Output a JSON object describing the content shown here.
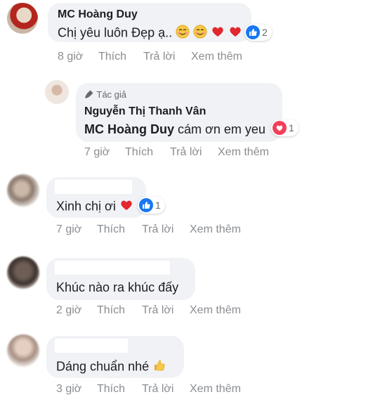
{
  "comments": [
    {
      "author": "MC Hoàng Duy",
      "text": "Chị yêu luôn Đẹp ạ..",
      "time": "8 giờ",
      "like": "Thích",
      "reply": "Trả lời",
      "more": "Xem thêm",
      "reaction_icon": "like-icon",
      "reaction_count": "2"
    },
    {
      "badge": "Tác giả",
      "author": "Nguyễn Thị Thanh Vân",
      "mention": "MC Hoàng Duy",
      "text": "cám ơn em yeu",
      "time": "7 giờ",
      "like": "Thích",
      "reply": "Trả lời",
      "more": "Xem thêm",
      "reaction_icon": "love-icon",
      "reaction_count": "1"
    },
    {
      "text": "Xinh chị ơi",
      "time": "7 giờ",
      "like": "Thích",
      "reply": "Trả lời",
      "more": "Xem thêm",
      "reaction_icon": "like-icon",
      "reaction_count": "1"
    },
    {
      "text": "Khúc nào ra khúc đấy",
      "time": "2 giờ",
      "like": "Thích",
      "reply": "Trả lời",
      "more": "Xem thêm"
    },
    {
      "text": "Dáng chuẩn nhé",
      "time": "3 giờ",
      "like": "Thích",
      "reply": "Trả lời",
      "more": "Xem thêm"
    }
  ],
  "colors": {
    "bubble": "#f0f2f5",
    "meta": "#8a8d91",
    "like_blue": "#1877f2",
    "love_red": "#f33e58"
  }
}
